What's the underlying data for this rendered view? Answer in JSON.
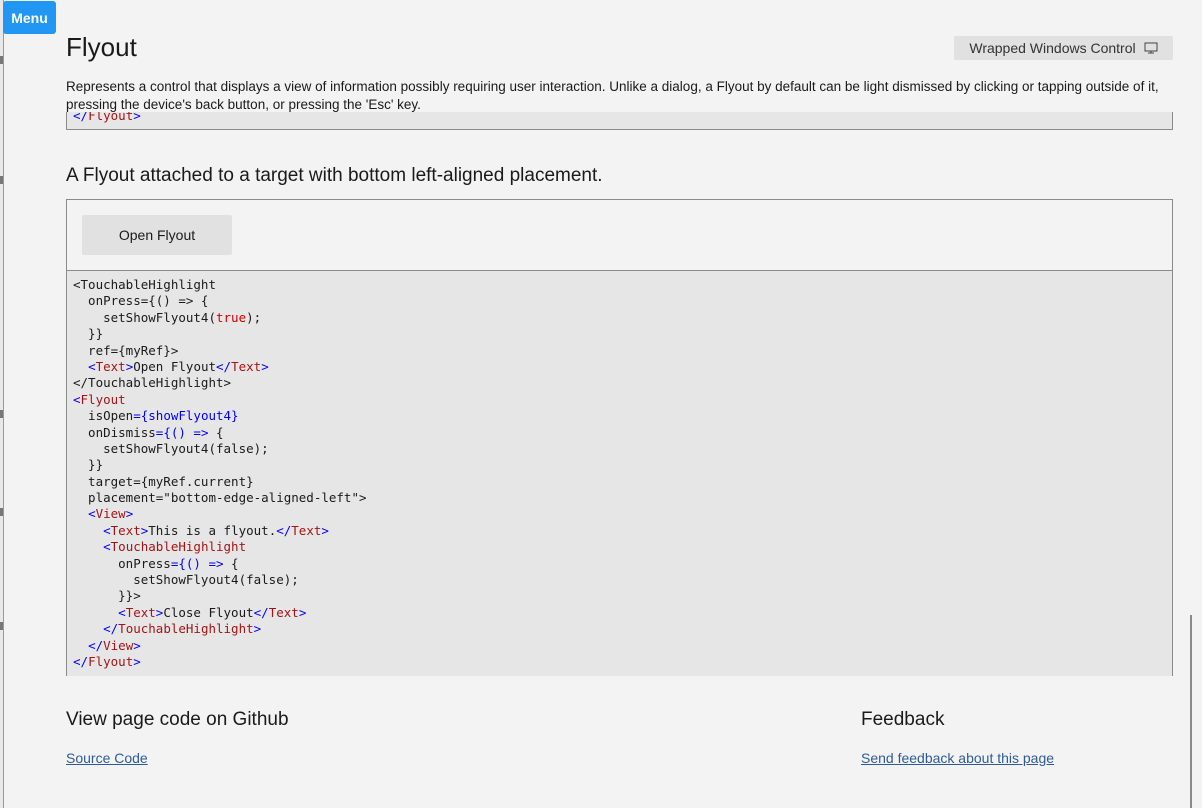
{
  "menu": {
    "label": "Menu"
  },
  "page": {
    "title": "Flyout",
    "description": "Represents a control that displays a view of information possibly requiring user interaction. Unlike a dialog, a Flyout by default can be light dismissed by clicking or tapping outside of it, pressing the device's back button, or pressing the 'Esc' key."
  },
  "wrapped_control": {
    "label": "Wrapped Windows Control",
    "icon": "monitor-icon"
  },
  "previous_example": {
    "code_tail": [
      [
        {
          "t": "</",
          "c": "#0000ff"
        },
        {
          "t": "Flyout",
          "c": "#a31515"
        },
        {
          "t": ">",
          "c": "#0000ff"
        }
      ]
    ]
  },
  "example": {
    "heading": "A Flyout attached to a target with bottom left-aligned placement.",
    "button_label": "Open Flyout",
    "code_lines": [
      [
        {
          "t": "<TouchableHighlight",
          "c": "#1a1a1a"
        }
      ],
      [
        {
          "t": "  onPress={() => {",
          "c": "#1a1a1a"
        }
      ],
      [
        {
          "t": "    setShowFlyout4(",
          "c": "#1a1a1a"
        },
        {
          "t": "true",
          "c": "#d00000"
        },
        {
          "t": ");",
          "c": "#1a1a1a"
        }
      ],
      [
        {
          "t": "  }}",
          "c": "#1a1a1a"
        }
      ],
      [
        {
          "t": "  ref={myRef}>",
          "c": "#1a1a1a"
        }
      ],
      [
        {
          "t": "  ",
          "c": "#1a1a1a"
        },
        {
          "t": "<",
          "c": "#0000ff"
        },
        {
          "t": "Text",
          "c": "#a31515"
        },
        {
          "t": ">",
          "c": "#0000ff"
        },
        {
          "t": "Open Flyout",
          "c": "#1a1a1a"
        },
        {
          "t": "</",
          "c": "#0000ff"
        },
        {
          "t": "Text",
          "c": "#a31515"
        },
        {
          "t": ">",
          "c": "#0000ff"
        }
      ],
      [
        {
          "t": "</TouchableHighlight>",
          "c": "#1a1a1a"
        }
      ],
      [
        {
          "t": "<",
          "c": "#0000ff"
        },
        {
          "t": "Flyout",
          "c": "#a31515"
        }
      ],
      [
        {
          "t": "  isOpen",
          "c": "#1a1a1a"
        },
        {
          "t": "={showFlyout4}",
          "c": "#0000ff"
        }
      ],
      [
        {
          "t": "  onDismiss",
          "c": "#1a1a1a"
        },
        {
          "t": "={() =>",
          "c": "#0000ff"
        },
        {
          "t": " {",
          "c": "#1a1a1a"
        }
      ],
      [
        {
          "t": "    setShowFlyout4(false);",
          "c": "#1a1a1a"
        }
      ],
      [
        {
          "t": "  }}",
          "c": "#1a1a1a"
        }
      ],
      [
        {
          "t": "  target={myRef.current}",
          "c": "#1a1a1a"
        }
      ],
      [
        {
          "t": "  placement=\"bottom-edge-aligned-left\">",
          "c": "#1a1a1a"
        }
      ],
      [
        {
          "t": "  ",
          "c": "#1a1a1a"
        },
        {
          "t": "<",
          "c": "#0000ff"
        },
        {
          "t": "View",
          "c": "#a31515"
        },
        {
          "t": ">",
          "c": "#0000ff"
        }
      ],
      [
        {
          "t": "    ",
          "c": "#1a1a1a"
        },
        {
          "t": "<",
          "c": "#0000ff"
        },
        {
          "t": "Text",
          "c": "#a31515"
        },
        {
          "t": ">",
          "c": "#0000ff"
        },
        {
          "t": "This is a flyout.",
          "c": "#1a1a1a"
        },
        {
          "t": "</",
          "c": "#0000ff"
        },
        {
          "t": "Text",
          "c": "#a31515"
        },
        {
          "t": ">",
          "c": "#0000ff"
        }
      ],
      [
        {
          "t": "    ",
          "c": "#1a1a1a"
        },
        {
          "t": "<",
          "c": "#0000ff"
        },
        {
          "t": "TouchableHighlight",
          "c": "#a31515"
        }
      ],
      [
        {
          "t": "      onPress",
          "c": "#1a1a1a"
        },
        {
          "t": "={() =>",
          "c": "#0000ff"
        },
        {
          "t": " {",
          "c": "#1a1a1a"
        }
      ],
      [
        {
          "t": "        setShowFlyout4(false);",
          "c": "#1a1a1a"
        }
      ],
      [
        {
          "t": "      }}>",
          "c": "#1a1a1a"
        }
      ],
      [
        {
          "t": "      ",
          "c": "#1a1a1a"
        },
        {
          "t": "<",
          "c": "#0000ff"
        },
        {
          "t": "Text",
          "c": "#a31515"
        },
        {
          "t": ">",
          "c": "#0000ff"
        },
        {
          "t": "Close Flyout",
          "c": "#1a1a1a"
        },
        {
          "t": "</",
          "c": "#0000ff"
        },
        {
          "t": "Text",
          "c": "#a31515"
        },
        {
          "t": ">",
          "c": "#0000ff"
        }
      ],
      [
        {
          "t": "    ",
          "c": "#1a1a1a"
        },
        {
          "t": "</",
          "c": "#0000ff"
        },
        {
          "t": "TouchableHighlight",
          "c": "#a31515"
        },
        {
          "t": ">",
          "c": "#0000ff"
        }
      ],
      [
        {
          "t": "  ",
          "c": "#1a1a1a"
        },
        {
          "t": "</",
          "c": "#0000ff"
        },
        {
          "t": "View",
          "c": "#a31515"
        },
        {
          "t": ">",
          "c": "#0000ff"
        }
      ],
      [
        {
          "t": "</",
          "c": "#0000ff"
        },
        {
          "t": "Flyout",
          "c": "#a31515"
        },
        {
          "t": ">",
          "c": "#0000ff"
        }
      ]
    ]
  },
  "footer": {
    "github_heading": "View page code on Github",
    "source_link": "Source Code",
    "feedback_heading": "Feedback",
    "feedback_link": "Send feedback about this page"
  },
  "colors": {
    "accent": "#2196f3",
    "link": "#2e5c99",
    "code_blue": "#0000ff",
    "code_red": "#a31515"
  }
}
